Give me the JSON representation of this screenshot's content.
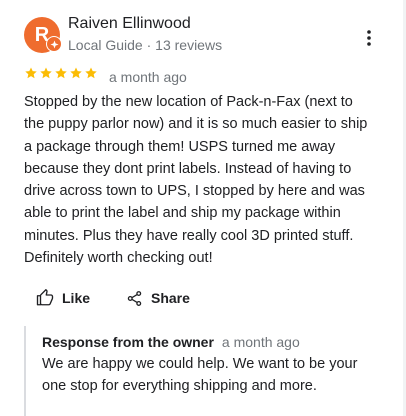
{
  "review": {
    "author": {
      "name": "Raiven Ellinwood",
      "meta": "Local Guide · 13 reviews",
      "avatar_letter": "R",
      "avatar_color": "#ef6c2e"
    },
    "rating": 5,
    "rating_max": 5,
    "star_color": "#fbbc04",
    "time": "a month ago",
    "text_lines": [
      "Stopped by the new location of Pack-n-Fax (next to",
      "the puppy parlor now) and it is so much easier to ship",
      "a package through them! USPS turned me away",
      "because they dont print labels. Instead of having to",
      "drive across town to UPS, I stopped by here and was",
      "able to print the label and ship my package within",
      "minutes. Plus they have really cool 3D printed stuff.",
      "Definitely worth checking out!"
    ],
    "actions": {
      "like_label": "Like",
      "share_label": "Share"
    },
    "owner_response": {
      "title": "Response from the owner",
      "time": "a month ago",
      "text_lines": [
        "We are happy we could help. We want to be your",
        "one stop for everything shipping and more."
      ]
    }
  },
  "icons": {
    "more": "more-vert-icon",
    "like": "thumb-up-icon",
    "share": "share-icon",
    "badge": "local-guide-badge-icon"
  }
}
